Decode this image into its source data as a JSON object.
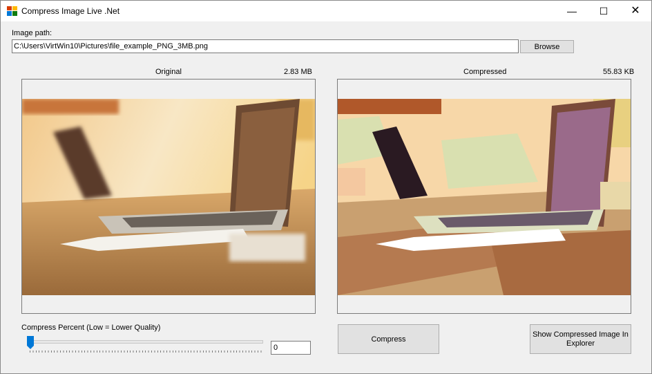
{
  "window": {
    "title": "Compress Image Live .Net",
    "controls": {
      "minimize": "—",
      "maximize": "☐",
      "close": "✕"
    }
  },
  "path": {
    "label": "Image path:",
    "value": "C:\\Users\\VirtWin10\\Pictures\\file_example_PNG_3MB.png",
    "browse_label": "Browse"
  },
  "original": {
    "label": "Original",
    "size": "2.83 MB"
  },
  "compressed": {
    "label": "Compressed",
    "size": "55.83 KB"
  },
  "slider": {
    "label": "Compress Percent (Low = Lower Quality)",
    "value": "0",
    "level_fraction": 0
  },
  "buttons": {
    "compress": "Compress",
    "explorer_line1": "Show Compressed Image In",
    "explorer_line2": "Explorer"
  },
  "colors": {
    "accent": "#0078d7",
    "window_bg": "#f0f0f0",
    "button_bg": "#e1e1e1"
  }
}
